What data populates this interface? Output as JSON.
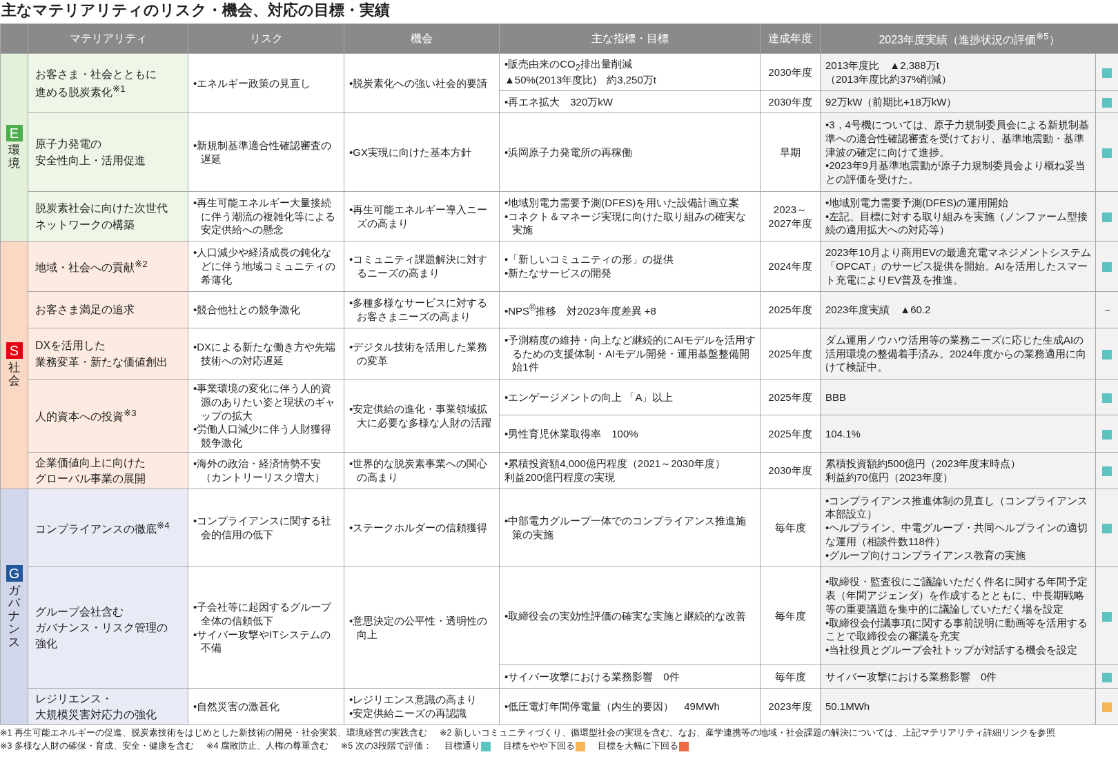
{
  "title": "主なマテリアリティのリスク・機会、対応の目標・実績",
  "columns": [
    "マテリアリティ",
    "リスク",
    "機会",
    "主な指標・目標",
    "達成年度",
    "2023年度実績（進捗状況の評価$^{※5}$）"
  ],
  "categories": [
    {
      "kind": "environment",
      "letter": "E",
      "label": "環境",
      "items": [
        {
          "name": [
            "お客さま・社会とともに",
            "進める脱炭素化$^{※1}$"
          ],
          "risks": [
            "•エネルギー政策の見直し"
          ],
          "opportunities": [
            "•脱炭素化への強い社会的要請"
          ],
          "targets": [
            {
              "indicators": [
                "•販売由来のCO$_{2}$排出量削減",
                "▲50%(2013年度比)　約3,250万t"
              ],
              "year": "2030年度",
              "results": [
                "2013年度比　▲2,388万t",
                "（2013年度比約37%削減）"
              ],
              "color": "#5bc4c0"
            },
            {
              "indicators": [
                "•再エネ拡大　320万kW"
              ],
              "year": "2030年度",
              "results": [
                "92万kW（前期比+18万kW）"
              ],
              "color": "#5bc4c0"
            }
          ]
        },
        {
          "name": [
            "原子力発電の",
            "安全性向上・活用促進"
          ],
          "risks": [
            "•新規制基準適合性確認審査の遅延"
          ],
          "opportunities": [
            "•GX実現に向けた基本方針"
          ],
          "targets": [
            {
              "indicators": [
                "•浜岡原子力発電所の再稼働"
              ],
              "year": "早期",
              "results": [
                "•3，4号機については、原子力規制委員会による新規制基準への適合性確認審査を受けており、基準地震動・基準津波の確定に向けて進捗。",
                "•2023年9月基準地震動が原子力規制委員会より概ね妥当との評価を受けた。"
              ],
              "color": "#5bc4c0"
            }
          ]
        },
        {
          "name": [
            "脱炭素社会に向けた次世代",
            "ネットワークの構築"
          ],
          "risks": [
            "•再生可能エネルギー大量接続に伴う潮流の複雑化等による安定供給への懸念"
          ],
          "opportunities": [
            "•再生可能エネルギー導入ニーズの高まり"
          ],
          "targets": [
            {
              "indicators": [
                "•地域別電力需要予測(DFES)を用いた設備計画立案",
                "•コネクト＆マネージ実現に向けた取り組みの確実な実施"
              ],
              "year": "2023～\n2027年度",
              "results": [
                "•地域別電力需要予測(DFES)の運用開始",
                "•左記、目標に対する取り組みを実施（ノンファーム型接続の適用拡大への対応等）"
              ],
              "color": "#5bc4c0"
            }
          ]
        }
      ]
    },
    {
      "kind": "social",
      "letter": "S",
      "label": "社会",
      "items": [
        {
          "name": [
            "地域・社会への貢献$^{※2}$"
          ],
          "risks": [
            "•人口減少や経済成長の鈍化などに伴う地域コミュニティの希薄化"
          ],
          "opportunities": [
            "•コミュニティ課題解決に対するニーズの高まり"
          ],
          "targets": [
            {
              "indicators": [
                "•「新しいコミュニティの形」の提供",
                "•新たなサービスの開発"
              ],
              "year": "2024年度",
              "results": [
                "2023年10月より商用EVの最適充電マネジメントシステム「OPCAT」のサービス提供を開始。AIを活用したスマート充電によりEV普及を推進。"
              ],
              "color": "#5bc4c0"
            }
          ]
        },
        {
          "name": [
            "お客さま満足の追求"
          ],
          "risks": [
            "•競合他社との競争激化"
          ],
          "opportunities": [
            "•多種多様なサービスに対するお客さまニーズの高まり"
          ],
          "targets": [
            {
              "indicators": [
                "•NPS$^{®}$推移　対2023年度差異 +8"
              ],
              "year": "2025年度",
              "results": [
                "2023年度実績　▲60.2"
              ],
              "rating_text": "－"
            }
          ]
        },
        {
          "name": [
            "DXを活用した",
            "業務変革・新たな価値創出"
          ],
          "risks": [
            "•DXによる新たな働き方や先端技術への対応遅延"
          ],
          "opportunities": [
            "•デジタル技術を活用した業務の変革"
          ],
          "targets": [
            {
              "indicators": [
                "•予測精度の維持・向上など継続的にAIモデルを活用するための支援体制・AIモデル開発・運用基盤整備開始1件"
              ],
              "year": "2025年度",
              "results": [
                "ダム運用ノウハウ活用等の業務ニーズに応じた生成AIの活用環境の整備着手済み。2024年度からの業務適用に向けて検証中。"
              ],
              "color": "#5bc4c0"
            }
          ]
        },
        {
          "name": [
            "人的資本への投資$^{※3}$"
          ],
          "risks": [
            "•事業環境の変化に伴う人的資源のありたい姿と現状のギャップの拡大",
            "•労働人口減少に伴う人財獲得競争激化"
          ],
          "opportunities": [
            "•安定供給の進化・事業領域拡大に必要な多様な人財の活躍"
          ],
          "targets": [
            {
              "indicators": [
                "•エンゲージメントの向上 「A」以上"
              ],
              "year": "2025年度",
              "results": [
                "BBB"
              ],
              "color": "#5bc4c0"
            },
            {
              "indicators": [
                "•男性育児休業取得率　100%"
              ],
              "year": "2025年度",
              "results": [
                "104.1%"
              ],
              "color": "#5bc4c0"
            }
          ]
        },
        {
          "name": [
            "企業価値向上に向けた",
            "グローバル事業の展開"
          ],
          "risks": [
            "•海外の政治・経済情勢不安（カントリーリスク増大）"
          ],
          "opportunities": [
            "•世界的な脱炭素事業への関心の高まり"
          ],
          "targets": [
            {
              "indicators": [
                "•累積投資額4,000億円程度（2021～2030年度）",
                "利益200億円程度の実現"
              ],
              "year": "2030年度",
              "results": [
                "累積投資額約500億円（2023年度末時点）",
                "利益約70億円（2023年度）"
              ],
              "color": "#5bc4c0"
            }
          ]
        }
      ]
    },
    {
      "kind": "governance",
      "letter": "G",
      "label": "ガバナンス",
      "items": [
        {
          "name": [
            "コンプライアンスの徹底$^{※4}$"
          ],
          "risks": [
            "•コンプライアンスに関する社会的信用の低下"
          ],
          "opportunities": [
            "•ステークホルダーの信頼獲得"
          ],
          "targets": [
            {
              "indicators": [
                "•中部電力グループ一体でのコンプライアンス推進施策の実施"
              ],
              "year": "毎年度",
              "results": [
                "•コンプライアンス推進体制の見直し（コンプライアンス本部設立）",
                "•ヘルプライン、中電グループ・共同ヘルプラインの適切な運用（相談件数118件）",
                "•グループ向けコンプライアンス教育の実施"
              ],
              "color": "#5bc4c0"
            }
          ]
        },
        {
          "name": [
            "グループ会社含む",
            "ガバナンス・リスク管理の",
            "強化"
          ],
          "risks": [
            "•子会社等に起因するグループ全体の信頼低下",
            "•サイバー攻撃やITシステムの不備"
          ],
          "opportunities": [
            "•意思決定の公平性・透明性の向上"
          ],
          "targets": [
            {
              "indicators": [
                "•取締役会の実効性評価の確実な実施と継続的な改善"
              ],
              "year": "毎年度",
              "results": [
                "•取締役・監査役にご議論いただく件名に関する年間予定表（年間アジェンダ）を作成するとともに、中長期戦略等の重要議題を集中的に議論していただく場を設定",
                "•取締役会付議事項に関する事前説明に動画等を活用することで取締役会の審議を充実",
                "•当社役員とグループ会社トップが対話する機会を設定"
              ],
              "color": "#5bc4c0"
            },
            {
              "indicators": [
                "•サイバー攻撃における業務影響　0件"
              ],
              "year": "毎年度",
              "results": [
                "サイバー攻撃における業務影響　0件"
              ],
              "color": "#5bc4c0"
            }
          ]
        },
        {
          "name": [
            "レジリエンス・",
            "大規模災害対応力の強化"
          ],
          "risks": [
            "•自然災害の激甚化"
          ],
          "opportunities": [
            "•レジリエンス意識の高まり",
            "•安定供給ニーズの再認識"
          ],
          "targets": [
            {
              "indicators": [
                "•低圧電灯年間停電量（内生的要因）　49MWh"
              ],
              "year": "2023年度",
              "results": [
                "50.1MWh"
              ],
              "color": "#f5b653"
            }
          ]
        }
      ]
    }
  ],
  "footnotes": [
    "※1 再生可能エネルギーの促進、脱炭素技術をはじめとした新技術の開発・社会実装、環境経営の実践含む",
    "※2 新しいコミュニティづくり、循環型社会の実現を含む。なお、産学連携等の地域・社会課題の解決については、上記マテリアリティ詳細リンクを参照",
    "※3 多様な人財の確保・育成、安全・健康を含む",
    "※4 腐敗防止、人権の尊重含む"
  ],
  "legend_intro": "※5 次の3段階で評価：",
  "legend": [
    {
      "label": "目標通り",
      "color": "#5bc4c0"
    },
    {
      "label": "目標をやや下回る",
      "color": "#f5b653"
    },
    {
      "label": "目標を大幅に下回る",
      "color": "#ee6a45"
    }
  ]
}
